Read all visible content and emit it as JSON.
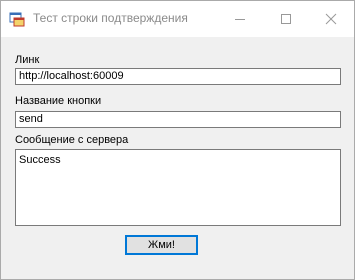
{
  "window": {
    "title": "Тест строки подтверждения"
  },
  "form": {
    "link_label": "Линк",
    "link_value": "http://localhost:60009",
    "button_name_label": "Название кнопки",
    "button_name_value": "send",
    "server_message_label": "Сообщение с сервера",
    "server_message_value": "Success",
    "submit_label": "Жми!"
  },
  "colors": {
    "window_bg": "#f0f0f0",
    "titlebar_bg": "#ffffff",
    "button_focus_border": "#0078d7"
  },
  "icons": {
    "app": "form-app-icon",
    "minimize": "minimize-icon",
    "maximize": "maximize-icon",
    "close": "close-icon"
  }
}
